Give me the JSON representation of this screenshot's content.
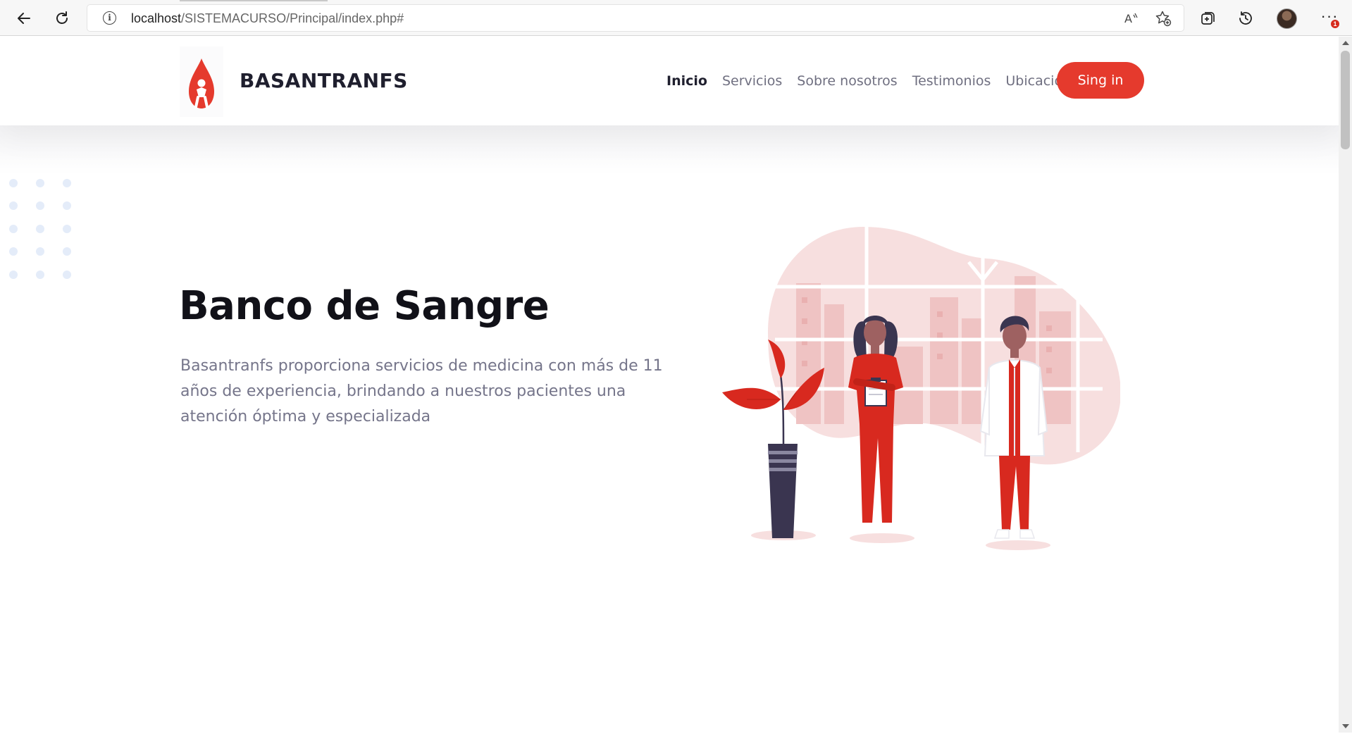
{
  "browser": {
    "url_host": "localhost",
    "url_path": "/SISTEMACURSO/Principal/index.php#",
    "notification_count": "1",
    "icons": [
      "back-icon",
      "refresh-icon",
      "info-icon",
      "read-aloud-icon",
      "favorite-add-icon",
      "collections-icon",
      "history-icon",
      "profile-avatar",
      "more-icon"
    ]
  },
  "header": {
    "brand": "BASANTRANFS",
    "nav": [
      {
        "label": "Inicio",
        "active": true
      },
      {
        "label": "Servicios",
        "active": false
      },
      {
        "label": "Sobre nosotros",
        "active": false
      },
      {
        "label": "Testimonios",
        "active": false
      },
      {
        "label": "Ubicación",
        "active": false
      }
    ],
    "signin_label": "Sing in"
  },
  "hero": {
    "title": "Banco de Sangre",
    "description": "Basantranfs proporciona servicios de medicina con más de 11 años de experiencia, brindando a nuestros pacientes una atención óptima y especializada"
  },
  "colors": {
    "accent": "#e53a2d",
    "heading": "#111118",
    "body_text": "#75758a",
    "nav_text": "#6f6f80",
    "dots": "#e4ecf9"
  }
}
